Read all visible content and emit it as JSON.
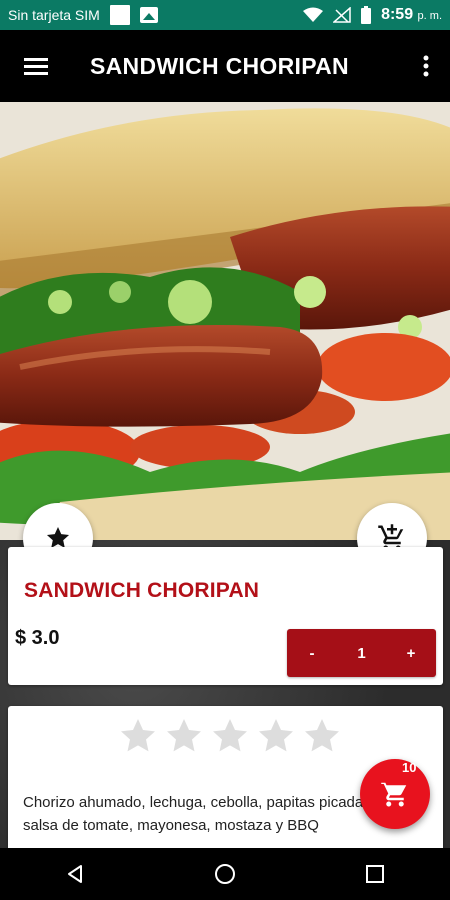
{
  "status_bar": {
    "carrier": "Sin tarjeta SIM",
    "time": "8:59",
    "ampm": "p. m."
  },
  "app_bar": {
    "title": "SANDWICH CHORIPAN",
    "menu_icon": "menu-icon",
    "more_icon": "more-vert-icon"
  },
  "hero_image": {
    "subject": "sandwich-choripan-photo"
  },
  "product": {
    "name": "SANDWICH CHORIPAN",
    "price": "$ 3.0",
    "quantity": {
      "minus": "-",
      "value": "1",
      "plus": "+"
    }
  },
  "rating": {
    "stars_total": 5,
    "stars_filled": 0
  },
  "description": "Chorizo ahumado, lechuga, cebolla, papitas picadas, salsa de tomate, mayonesa, mostaza y BBQ",
  "cart": {
    "count": "10"
  },
  "colors": {
    "status_bar": "#0b7a64",
    "app_bar": "#000000",
    "accent_red": "#b31018",
    "qty_red": "#a50f17",
    "fab_red": "#e8121e",
    "star_empty": "#dddddd"
  }
}
